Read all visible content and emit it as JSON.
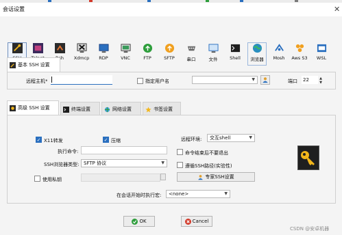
{
  "window": {
    "title": "会话设置"
  },
  "protocols": [
    {
      "label": "SSH",
      "icon": "ssh-icon",
      "selected": true
    },
    {
      "label": "Telnet",
      "icon": "telnet-icon"
    },
    {
      "label": "Rsh",
      "icon": "rsh-icon"
    },
    {
      "label": "Xdmcp",
      "icon": "xdmcp-icon"
    },
    {
      "label": "RDP",
      "icon": "rdp-icon"
    },
    {
      "label": "VNC",
      "icon": "vnc-icon"
    },
    {
      "label": "FTP",
      "icon": "ftp-icon"
    },
    {
      "label": "SFTP",
      "icon": "sftp-icon"
    },
    {
      "label": "串口",
      "icon": "serial-icon"
    },
    {
      "label": "文件",
      "icon": "file-icon"
    },
    {
      "label": "Shell",
      "icon": "shell-icon"
    },
    {
      "label": "浏览器",
      "icon": "browser-icon"
    },
    {
      "label": "Mosh",
      "icon": "mosh-icon"
    },
    {
      "label": "Aws S3",
      "icon": "aws-s3-icon"
    },
    {
      "label": "WSL",
      "icon": "wsl-icon"
    }
  ],
  "basic": {
    "tab_label": "基本 SSH 设置",
    "remote_host_label": "远程主机",
    "remote_host_required": "*",
    "remote_host_value": "",
    "specify_user_label": "指定用户名",
    "username_value": "",
    "port_label": "端口",
    "port_value": "22"
  },
  "advanced_tabs": [
    {
      "label": "高级 SSH 设置",
      "icon": "gear-icon",
      "active": true
    },
    {
      "label": "终端设置",
      "icon": "terminal-icon"
    },
    {
      "label": "网络设置",
      "icon": "network-icon"
    },
    {
      "label": "书签设置",
      "icon": "star-icon"
    }
  ],
  "advanced": {
    "x11_label": "X11转发",
    "x11_checked": true,
    "compress_label": "压缩",
    "compress_checked": true,
    "remote_env_label": "远程环境:",
    "remote_env_value": "交互shell",
    "exec_cmd_label": "执行命令:",
    "exec_cmd_value": "",
    "no_exit_label": "命令结束后不要退出",
    "no_exit_checked": false,
    "browser_type_label": "SSH浏览器类型:",
    "browser_type_value": "SFTP 协议",
    "follow_path_label": "遵循SSH路径(实验性)",
    "follow_path_checked": false,
    "private_key_label": "使用私钥",
    "private_key_checked": false,
    "private_key_value": "",
    "expert_button": "专家SSH设置",
    "startup_macro_label": "在会话开始时执行宏:",
    "startup_macro_value": "<none>",
    "key_icon": "key-icon"
  },
  "buttons": {
    "ok": "OK",
    "cancel": "Cancel"
  },
  "watermark": "CSDN @安卓机器",
  "colors": {
    "accent": "#2a6fbf",
    "key_tile": "#1f1f1f",
    "key": "#f2b61b",
    "ok_green": "#2e9e3c",
    "cancel_red": "#d23a2a"
  }
}
